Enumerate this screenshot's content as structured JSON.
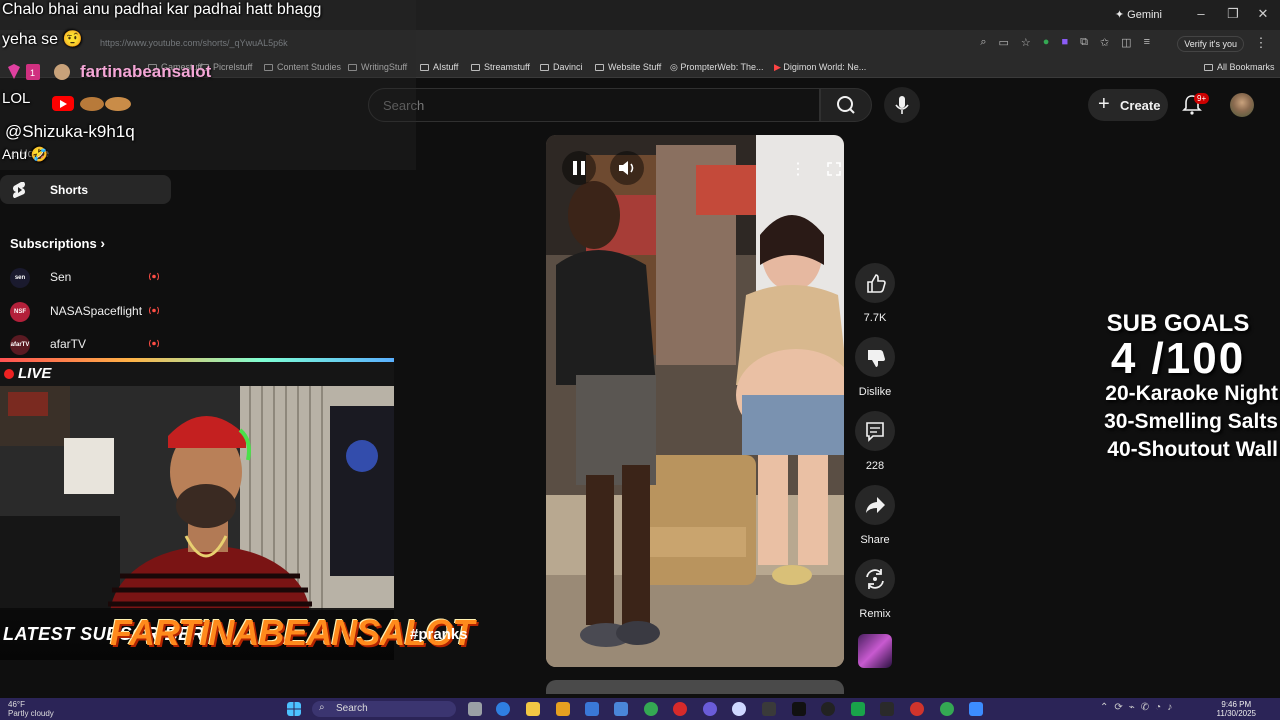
{
  "browser": {
    "url": "https://www.youtube.com/shorts/_qYwuAL5p6k",
    "gemini_label": "Gemini",
    "profile_label": "Verify it's you",
    "bookmarks": [
      "Gamestuff",
      "Picrelstuff",
      "Content Studies",
      "WritingStuff",
      "AIstuff",
      "Streamstuff",
      "Davinci",
      "Website Stuff",
      "PrompterWeb: The...",
      "Digimon World: Ne...",
      "All Bookmarks"
    ],
    "window_controls": [
      "–",
      "❐",
      "✕"
    ]
  },
  "youtube": {
    "search_placeholder": "Search",
    "create_label": "Create",
    "notification_badge": "9+",
    "sidebar": {
      "home_label": "Home",
      "shorts_label": "Shorts",
      "subscriptions_label": "Subscriptions",
      "subscriptions": [
        {
          "name": "Sen",
          "avatar_text": "sen",
          "color": "#1a1a2e"
        },
        {
          "name": "NASASpaceflight",
          "avatar_text": "NSF",
          "color": "#b3203a"
        },
        {
          "name": "afarTV",
          "avatar_text": "afarTV",
          "color": "#5a1a22"
        }
      ]
    },
    "short": {
      "likes": "7.7K",
      "dislike_label": "Dislike",
      "comments": "228",
      "share_label": "Share",
      "remix_label": "Remix"
    }
  },
  "overlay": {
    "chat_message_line1": "Chalo bhai anu padhai kar padhai hatt bhagg",
    "chat_message_line2": "yeha se 🤨",
    "chat_username": "fartinabeansalot",
    "chat_message_lol": "LOL",
    "chat_mention": "@Shizuka-k9h1q",
    "chat_anu": "Anu 🤣",
    "live_label": "LIVE",
    "latest_sub_label": "LATEST SUBSCRIBER",
    "latest_sub_name": "FARTINABEANSALOT",
    "pranks_tag": "#pranks",
    "sub_goals": {
      "title": "SUB GOALS",
      "count": "4  /100",
      "goals": [
        "20-Karaoke Night",
        "30-Smelling Salts",
        "40-Shoutout Wall"
      ]
    }
  },
  "taskbar": {
    "weather_temp": "46°F",
    "weather_desc": "Partly cloudy",
    "search_label": "Search",
    "time": "9:46 PM",
    "date": "11/30/2025",
    "accent": "#2b2457"
  }
}
